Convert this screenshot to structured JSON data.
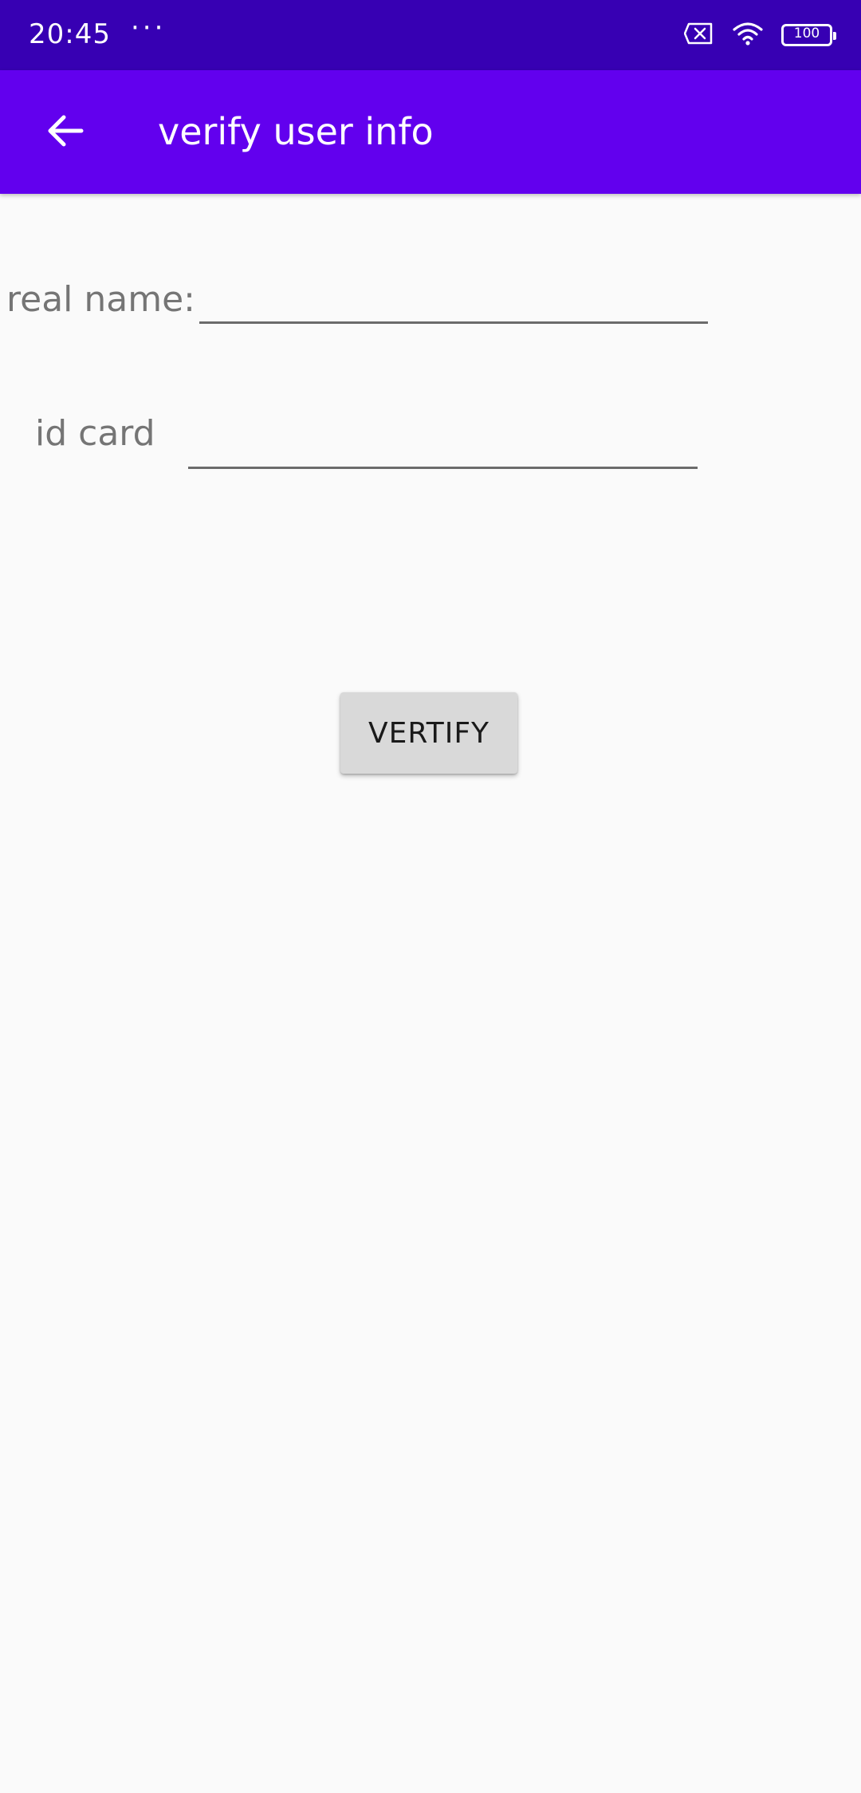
{
  "status_bar": {
    "time": "20:45",
    "overflow": "···",
    "icons": [
      "sim-error-icon",
      "wifi-icon",
      "battery-icon"
    ],
    "battery_level": "100"
  },
  "app_bar": {
    "back_icon": "arrow-left-icon",
    "title": "verify user info"
  },
  "form": {
    "real_name": {
      "label": "real name:",
      "value": "",
      "placeholder": ""
    },
    "id_card": {
      "label": "id card",
      "value": "",
      "placeholder": ""
    },
    "verify_button": "VERTIFY"
  },
  "colors": {
    "status_bar": "#3700b3",
    "app_bar": "#6200ee",
    "background": "#fafafa",
    "button": "#d9d9d9",
    "battery": "#4caf50"
  }
}
